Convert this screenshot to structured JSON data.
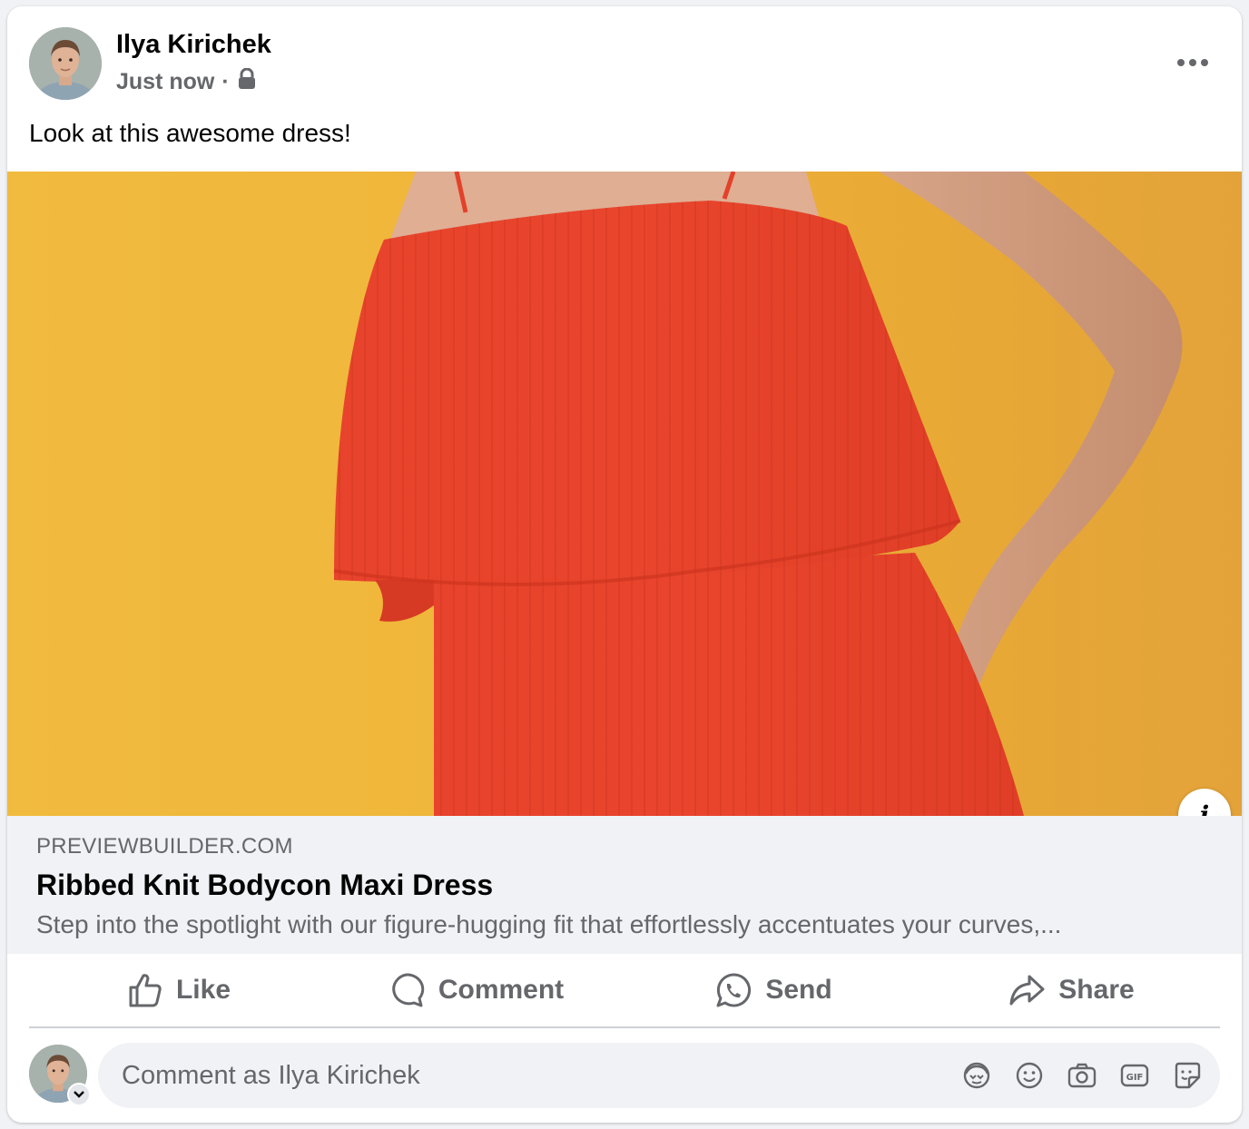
{
  "post": {
    "author": "Ilya Kirichek",
    "time": "Just now",
    "separator": "·",
    "privacy_icon": "lock-icon",
    "text": "Look at this awesome dress!"
  },
  "link_preview": {
    "domain": "PREVIEWBUILDER.COM",
    "title": "Ribbed Knit Bodycon Maxi Dress",
    "description": "Step into the spotlight with our figure-hugging fit that effortlessly accentuates your curves,..."
  },
  "actions": {
    "like": "Like",
    "comment": "Comment",
    "send": "Send",
    "share": "Share"
  },
  "comment_box": {
    "placeholder": "Comment as Ilya Kirichek",
    "icons": [
      "avatar-sticker-icon",
      "emoji-icon",
      "camera-icon",
      "gif-icon",
      "sticker-icon"
    ]
  },
  "colors": {
    "background": "#f0f2f5",
    "card": "#ffffff",
    "text_primary": "#050505",
    "text_secondary": "#65676b",
    "dress_red": "#e8442c",
    "backdrop_yellow": "#efb63a"
  }
}
